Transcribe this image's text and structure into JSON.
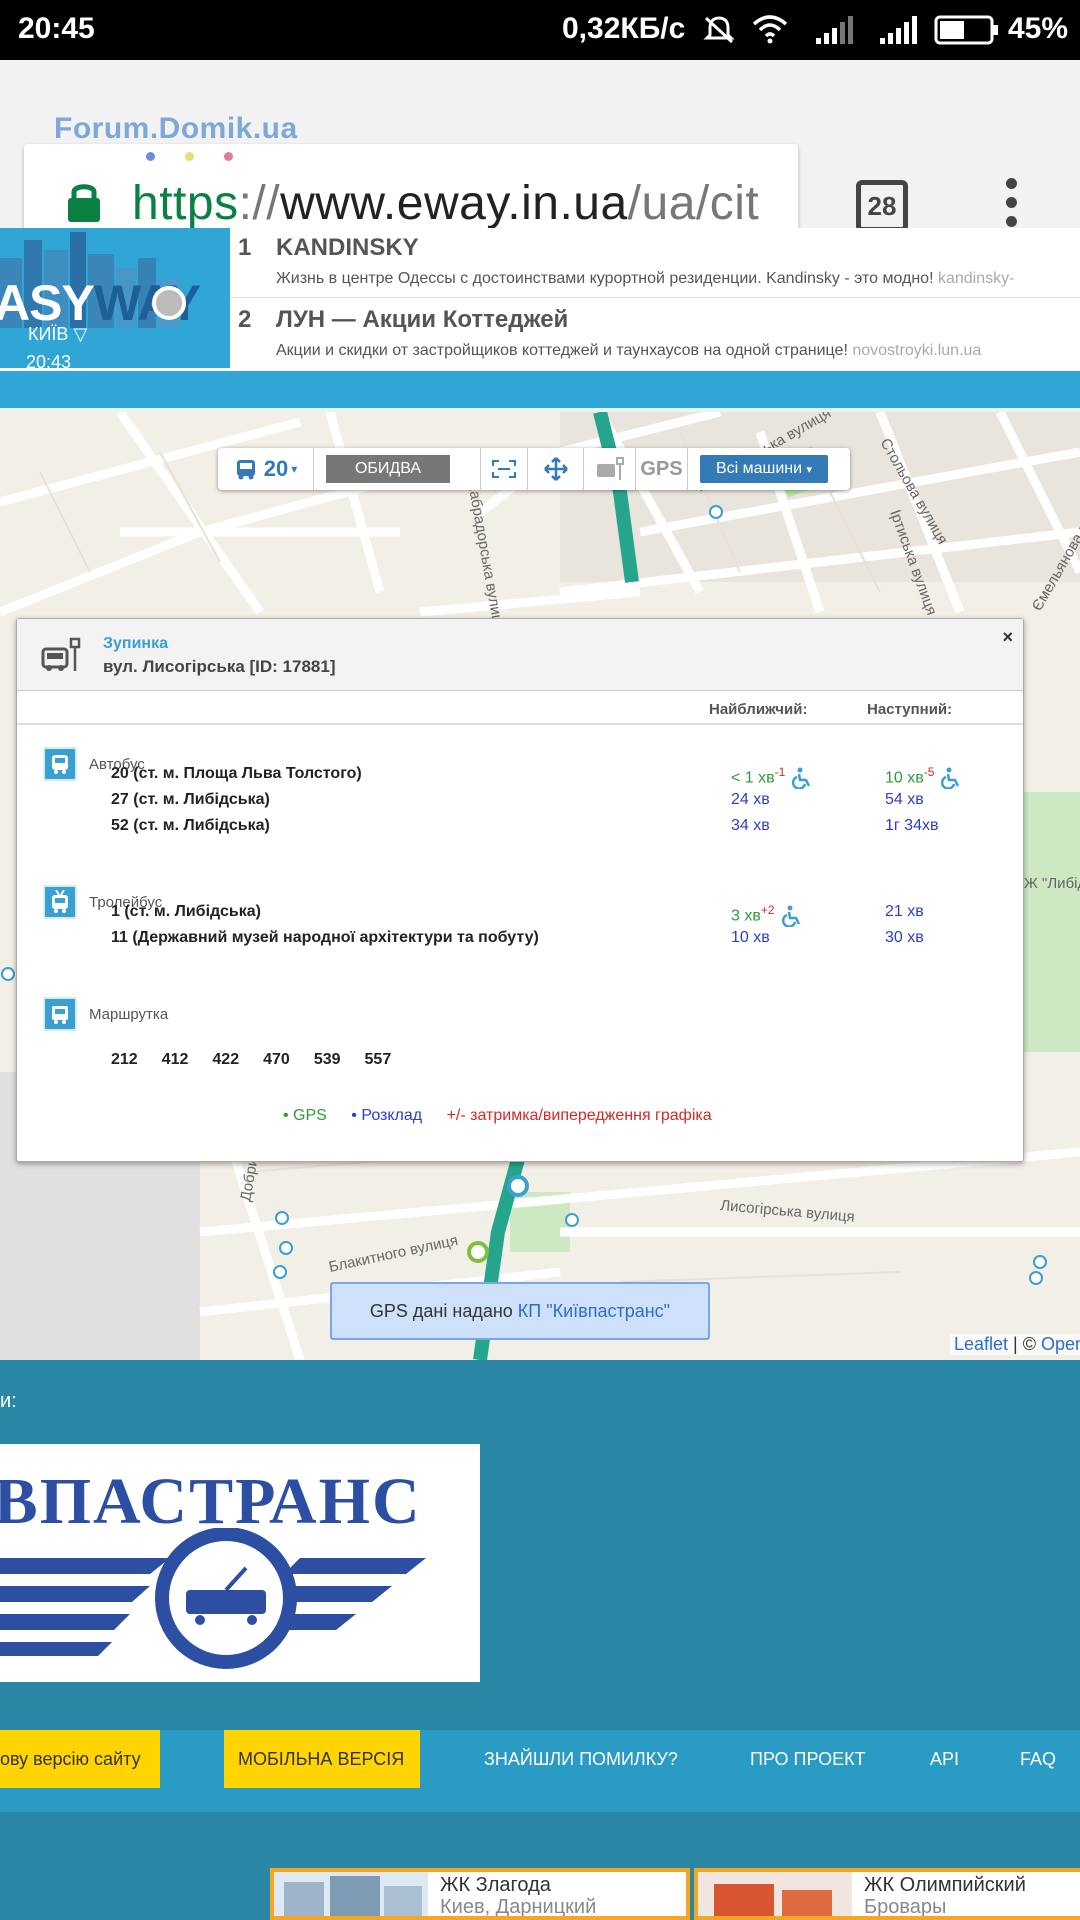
{
  "status_bar": {
    "time": "20:45",
    "speed": "0,32КБ/с",
    "battery": "45%",
    "icons": [
      "mute-icon",
      "wifi-icon",
      "signal-icon",
      "signal-icon",
      "battery-icon"
    ]
  },
  "browser": {
    "watermark": "Forum.Domik.ua",
    "url_scheme": "https",
    "url_sep": "://",
    "url_host": "www.eway.in.ua",
    "url_path": "/ua/cit",
    "tabs_count": "28"
  },
  "site": {
    "logo": {
      "prefix": "ASY",
      "suffix": "WAY"
    },
    "city": "КИЇВ",
    "time": "20:43",
    "ads": [
      {
        "num": "1",
        "title": "KANDINSKY",
        "desc": "Жизнь в центре Одессы с достоинствами курортной резиденции. Kandinsky - это модно!",
        "domain": "kandinsky-"
      },
      {
        "num": "2",
        "title": "ЛУН — Акции Коттеджей",
        "desc": "Акции и скидки от застройщиков коттеджей и таунхаусов на одной странице!",
        "domain": "novostroyki.lun.ua"
      }
    ]
  },
  "map": {
    "toolbar": {
      "route": "20",
      "route_name": "ОБИДВА",
      "gps": "GPS",
      "all_vehicles": "Всі машини"
    },
    "street_labels": [
      "Павлодарська вулиця",
      "Стольова вулиця",
      "Іртиська вулиця",
      "Ємельянова вулиця",
      "Лабрадорська вулиця",
      "Лисогірська вулиця",
      "Блакитного вулиця",
      "Добрий Шлях вулиця",
      "Ж \"Либід"
    ],
    "gps_note": {
      "text": "GPS дані надано ",
      "link": "КП \"Київпастранс\""
    },
    "attribution": {
      "leaflet": "Leaflet",
      "sep": " | © ",
      "osm": "Open"
    }
  },
  "popup": {
    "title": "Зупинка",
    "subtitle": "вул. Лисогірська [ID: 17881]",
    "close": "×",
    "col_nearest": "Найближчий:",
    "col_next": "Наступний:",
    "bus_label": "Автобус",
    "bus_routes": [
      {
        "name": "20 (ст. м. Площа Льва Толстого)",
        "near": "< 1 хв",
        "near_delay": "-1",
        "near_type": "gps",
        "near_wheel": true,
        "next": "10 хв",
        "next_delay": "-5",
        "next_type": "gps",
        "next_wheel": true
      },
      {
        "name": "27 (ст. м. Либідська)",
        "near": "24 хв",
        "near_delay": "",
        "near_type": "sched",
        "near_wheel": false,
        "next": "54 хв",
        "next_delay": "",
        "next_type": "sched",
        "next_wheel": false
      },
      {
        "name": "52 (ст. м. Либідська)",
        "near": "34 хв",
        "near_delay": "",
        "near_type": "sched",
        "near_wheel": false,
        "next": "1г 34хв",
        "next_delay": "",
        "next_type": "sched",
        "next_wheel": false
      }
    ],
    "trolley_label": "Тролейбус",
    "trolley_routes": [
      {
        "name": "1 (ст. м. Либідська)",
        "near": "3 хв",
        "near_delay": "+2",
        "near_type": "gps",
        "near_wheel": true,
        "next": "21 хв",
        "next_delay": "",
        "next_type": "sched",
        "next_wheel": false
      },
      {
        "name": "11 (Державний музей народної архітектури та побуту)",
        "near": "10 хв",
        "near_delay": "",
        "near_type": "sched",
        "near_wheel": false,
        "next": "30 хв",
        "next_delay": "",
        "next_type": "sched",
        "next_wheel": false
      }
    ],
    "marshrutka_label": "Маршрутка",
    "marshrutka_routes": [
      "212",
      "412",
      "422",
      "470",
      "539",
      "557"
    ],
    "legend": {
      "gps": "GPS",
      "sched": "Розклад",
      "delay": "+/- затримка/випередження графіка"
    }
  },
  "lower": {
    "label": "и:",
    "kpt_logo_text": "ЇВПАСТРАНС",
    "nav": {
      "full_version": "ову версію сайту",
      "mobile_version": "МОБІЛЬНА ВЕРСІЯ",
      "found_error": "ЗНАЙШЛИ ПОМИЛКУ?",
      "about": "ПРО ПРОЕКТ",
      "api": "API",
      "faq": "FAQ"
    },
    "promos": [
      {
        "title": "ЖК Злагода",
        "sub": "Киев, Дарницкий"
      },
      {
        "title": "ЖК Олимпийский",
        "sub": "Бровары"
      }
    ]
  }
}
